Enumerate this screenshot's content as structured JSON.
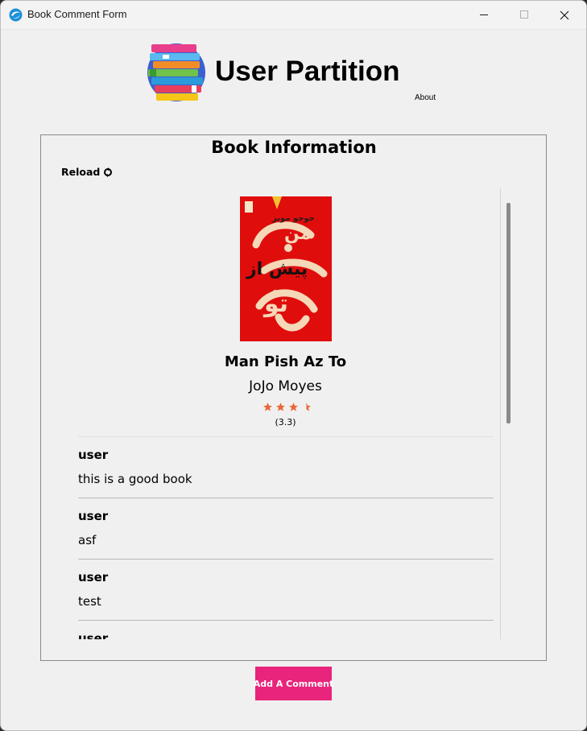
{
  "window": {
    "title": "Book Comment Form"
  },
  "header": {
    "title": "User Partition",
    "about_label": "About"
  },
  "panel": {
    "title": "Book Information",
    "reload_label": "Reload"
  },
  "book": {
    "cover_text_top": "جوجو مویز",
    "cover_title_line1": "من",
    "cover_title_line2": "پیش از",
    "cover_title_line3": "تو",
    "title": "Man Pish Az To",
    "author": "JoJo Moyes",
    "rating": 3.3,
    "rating_label": "(3.3)",
    "star_color": "#e8683a"
  },
  "comments": [
    {
      "user": "user",
      "text": "this is a good book"
    },
    {
      "user": "user",
      "text": "asf"
    },
    {
      "user": "user",
      "text": "test"
    },
    {
      "user": "user",
      "text": ""
    }
  ],
  "actions": {
    "add_comment_label": "Add A Comment"
  },
  "colors": {
    "accent": "#e8247c",
    "cover_red": "#e00d0d"
  }
}
